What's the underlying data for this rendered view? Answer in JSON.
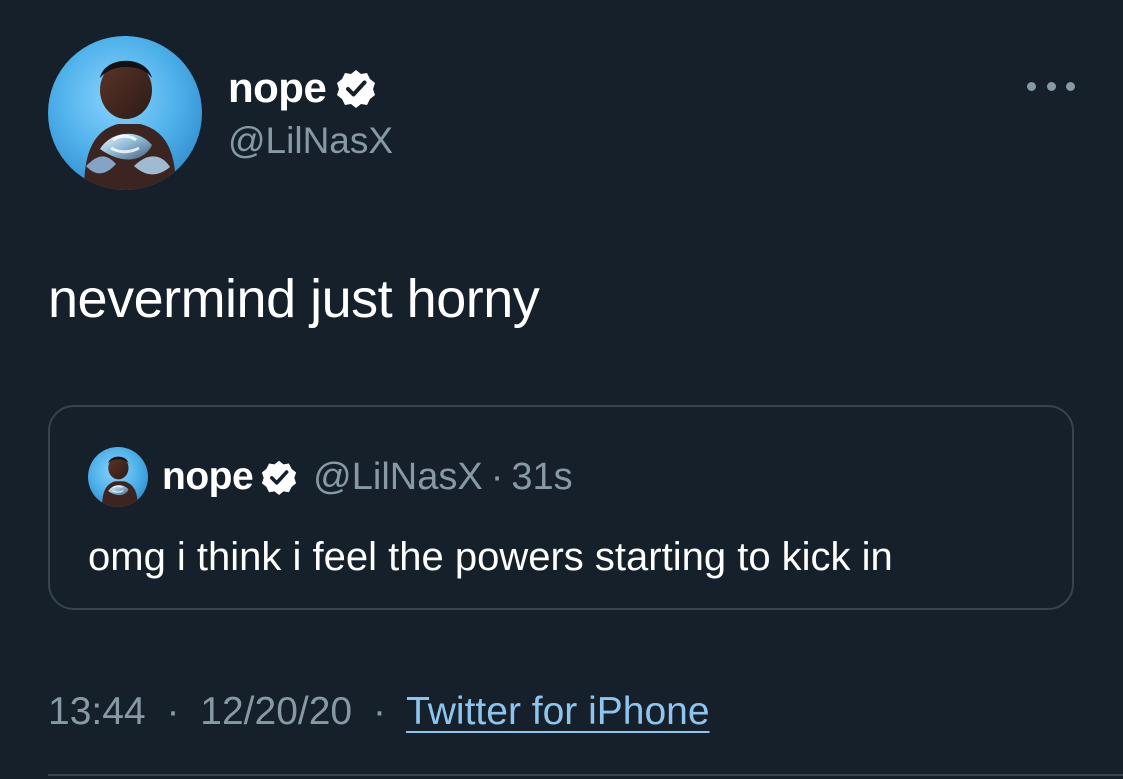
{
  "tweet": {
    "author": {
      "display_name": "nope",
      "handle": "@LilNasX",
      "avatar_icon": "profile-photo-icon",
      "verified_icon": "verified-badge-icon"
    },
    "text": "nevermind just horny",
    "quoted_tweet": {
      "display_name": "nope",
      "handle": "@LilNasX",
      "separator": "·",
      "age": "31s",
      "text": "omg i think i feel the powers starting to kick in"
    },
    "timestamp": {
      "time": "13:44",
      "date": "12/20/20",
      "separator": "·",
      "source": "Twitter for iPhone"
    }
  },
  "colors": {
    "background": "#15202b",
    "text": "#ffffff",
    "secondary_text": "#8899a6",
    "link": "#8ec5ef",
    "border": "#38444d",
    "verified": "#ffffff"
  }
}
